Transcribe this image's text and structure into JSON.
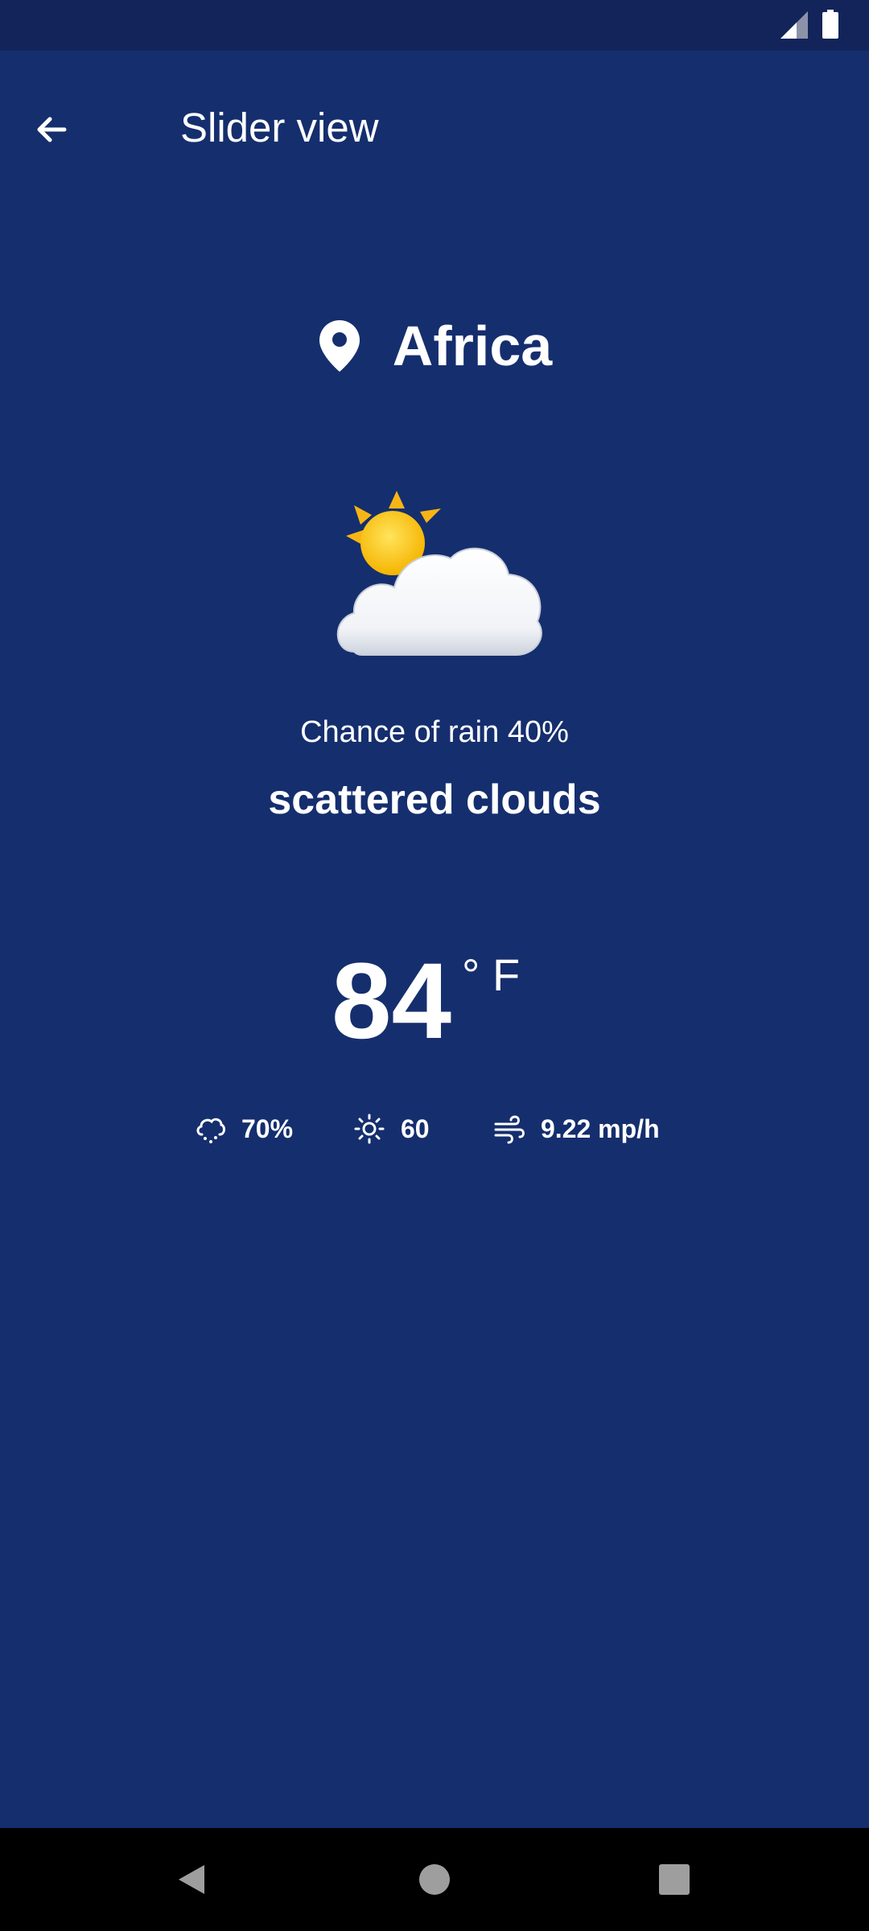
{
  "status_bar": {
    "signal_icon": "cell-signal-icon",
    "battery_icon": "battery-icon"
  },
  "app_bar": {
    "back_icon": "arrow-left-icon",
    "title": "Slider view"
  },
  "location": {
    "icon": "map-pin-icon",
    "name": "Africa"
  },
  "weather": {
    "art_icon": "sun-behind-cloud-icon",
    "chance_of_rain": "Chance of rain 40%",
    "description": "scattered clouds",
    "temperature": "84",
    "unit": "° F"
  },
  "stats": {
    "humidity": {
      "icon": "cloud-drizzle-icon",
      "value": "70%"
    },
    "uv": {
      "icon": "sun-icon",
      "value": "60"
    },
    "wind": {
      "icon": "wind-icon",
      "value": "9.22 mp/h"
    }
  },
  "nav_bar": {
    "back_icon": "nav-back-triangle-icon",
    "home_icon": "nav-home-circle-icon",
    "recents_icon": "nav-recents-square-icon"
  },
  "colors": {
    "background": "#152e6e",
    "status_bar": "#12245a",
    "text": "#ffffff",
    "nav_bar": "#000000"
  }
}
